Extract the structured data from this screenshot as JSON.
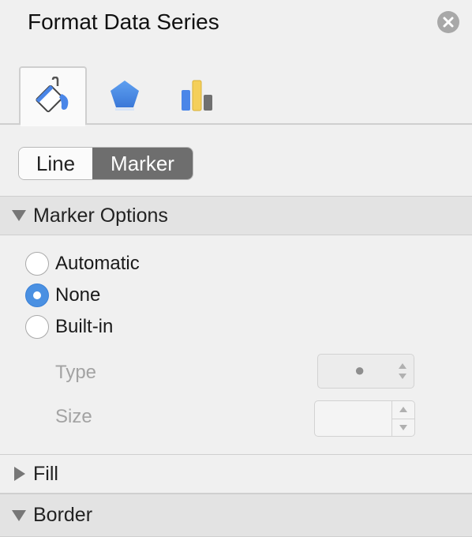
{
  "panel": {
    "title": "Format Data Series"
  },
  "icons": {
    "close": "close-icon",
    "tab_fill_line": "paint-bucket-icon",
    "tab_effects": "pentagon-icon",
    "tab_series_options": "bar-chart-icon"
  },
  "segmented": {
    "line_label": "Line",
    "marker_label": "Marker",
    "selected": "Marker"
  },
  "marker_options": {
    "header": "Marker Options",
    "expanded": true,
    "radio_automatic": "Automatic",
    "radio_none": "None",
    "radio_builtin": "Built-in",
    "selected": "None",
    "type_label": "Type",
    "type_value": "●",
    "size_label": "Size",
    "size_value": ""
  },
  "fill": {
    "header": "Fill",
    "expanded": false
  },
  "border": {
    "header": "Border",
    "expanded": true
  },
  "colors": {
    "accent": "#4a90e2",
    "segment_selected": "#6e6e6e",
    "chart_blue": "#4a86e8",
    "chart_yellow": "#f4cf5a",
    "chart_gray": "#707070"
  }
}
